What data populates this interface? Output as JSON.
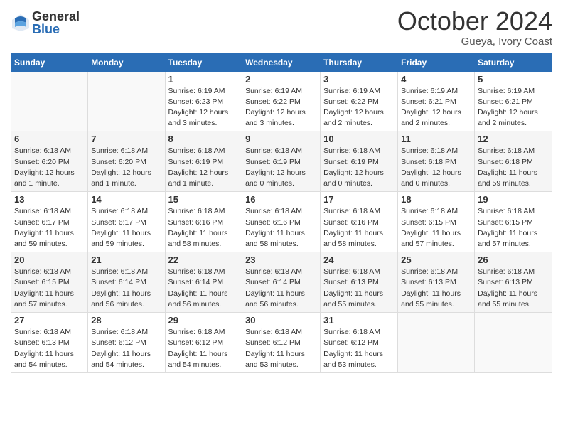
{
  "logo": {
    "general": "General",
    "blue": "Blue"
  },
  "title": "October 2024",
  "location": "Gueya, Ivory Coast",
  "days_of_week": [
    "Sunday",
    "Monday",
    "Tuesday",
    "Wednesday",
    "Thursday",
    "Friday",
    "Saturday"
  ],
  "weeks": [
    [
      {
        "day": "",
        "info": ""
      },
      {
        "day": "",
        "info": ""
      },
      {
        "day": "1",
        "info": "Sunrise: 6:19 AM\nSunset: 6:23 PM\nDaylight: 12 hours and 3 minutes."
      },
      {
        "day": "2",
        "info": "Sunrise: 6:19 AM\nSunset: 6:22 PM\nDaylight: 12 hours and 3 minutes."
      },
      {
        "day": "3",
        "info": "Sunrise: 6:19 AM\nSunset: 6:22 PM\nDaylight: 12 hours and 2 minutes."
      },
      {
        "day": "4",
        "info": "Sunrise: 6:19 AM\nSunset: 6:21 PM\nDaylight: 12 hours and 2 minutes."
      },
      {
        "day": "5",
        "info": "Sunrise: 6:19 AM\nSunset: 6:21 PM\nDaylight: 12 hours and 2 minutes."
      }
    ],
    [
      {
        "day": "6",
        "info": "Sunrise: 6:18 AM\nSunset: 6:20 PM\nDaylight: 12 hours and 1 minute."
      },
      {
        "day": "7",
        "info": "Sunrise: 6:18 AM\nSunset: 6:20 PM\nDaylight: 12 hours and 1 minute."
      },
      {
        "day": "8",
        "info": "Sunrise: 6:18 AM\nSunset: 6:19 PM\nDaylight: 12 hours and 1 minute."
      },
      {
        "day": "9",
        "info": "Sunrise: 6:18 AM\nSunset: 6:19 PM\nDaylight: 12 hours and 0 minutes."
      },
      {
        "day": "10",
        "info": "Sunrise: 6:18 AM\nSunset: 6:19 PM\nDaylight: 12 hours and 0 minutes."
      },
      {
        "day": "11",
        "info": "Sunrise: 6:18 AM\nSunset: 6:18 PM\nDaylight: 12 hours and 0 minutes."
      },
      {
        "day": "12",
        "info": "Sunrise: 6:18 AM\nSunset: 6:18 PM\nDaylight: 11 hours and 59 minutes."
      }
    ],
    [
      {
        "day": "13",
        "info": "Sunrise: 6:18 AM\nSunset: 6:17 PM\nDaylight: 11 hours and 59 minutes."
      },
      {
        "day": "14",
        "info": "Sunrise: 6:18 AM\nSunset: 6:17 PM\nDaylight: 11 hours and 59 minutes."
      },
      {
        "day": "15",
        "info": "Sunrise: 6:18 AM\nSunset: 6:16 PM\nDaylight: 11 hours and 58 minutes."
      },
      {
        "day": "16",
        "info": "Sunrise: 6:18 AM\nSunset: 6:16 PM\nDaylight: 11 hours and 58 minutes."
      },
      {
        "day": "17",
        "info": "Sunrise: 6:18 AM\nSunset: 6:16 PM\nDaylight: 11 hours and 58 minutes."
      },
      {
        "day": "18",
        "info": "Sunrise: 6:18 AM\nSunset: 6:15 PM\nDaylight: 11 hours and 57 minutes."
      },
      {
        "day": "19",
        "info": "Sunrise: 6:18 AM\nSunset: 6:15 PM\nDaylight: 11 hours and 57 minutes."
      }
    ],
    [
      {
        "day": "20",
        "info": "Sunrise: 6:18 AM\nSunset: 6:15 PM\nDaylight: 11 hours and 57 minutes."
      },
      {
        "day": "21",
        "info": "Sunrise: 6:18 AM\nSunset: 6:14 PM\nDaylight: 11 hours and 56 minutes."
      },
      {
        "day": "22",
        "info": "Sunrise: 6:18 AM\nSunset: 6:14 PM\nDaylight: 11 hours and 56 minutes."
      },
      {
        "day": "23",
        "info": "Sunrise: 6:18 AM\nSunset: 6:14 PM\nDaylight: 11 hours and 56 minutes."
      },
      {
        "day": "24",
        "info": "Sunrise: 6:18 AM\nSunset: 6:13 PM\nDaylight: 11 hours and 55 minutes."
      },
      {
        "day": "25",
        "info": "Sunrise: 6:18 AM\nSunset: 6:13 PM\nDaylight: 11 hours and 55 minutes."
      },
      {
        "day": "26",
        "info": "Sunrise: 6:18 AM\nSunset: 6:13 PM\nDaylight: 11 hours and 55 minutes."
      }
    ],
    [
      {
        "day": "27",
        "info": "Sunrise: 6:18 AM\nSunset: 6:13 PM\nDaylight: 11 hours and 54 minutes."
      },
      {
        "day": "28",
        "info": "Sunrise: 6:18 AM\nSunset: 6:12 PM\nDaylight: 11 hours and 54 minutes."
      },
      {
        "day": "29",
        "info": "Sunrise: 6:18 AM\nSunset: 6:12 PM\nDaylight: 11 hours and 54 minutes."
      },
      {
        "day": "30",
        "info": "Sunrise: 6:18 AM\nSunset: 6:12 PM\nDaylight: 11 hours and 53 minutes."
      },
      {
        "day": "31",
        "info": "Sunrise: 6:18 AM\nSunset: 6:12 PM\nDaylight: 11 hours and 53 minutes."
      },
      {
        "day": "",
        "info": ""
      },
      {
        "day": "",
        "info": ""
      }
    ]
  ]
}
